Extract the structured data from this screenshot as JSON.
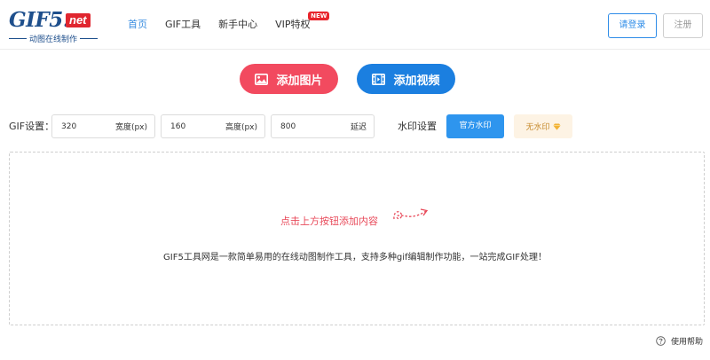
{
  "logo": {
    "main": "GIF5.",
    "net": "net",
    "subtitle": "动图在线制作"
  },
  "nav": [
    {
      "label": "首页",
      "active": true
    },
    {
      "label": "GIF工具"
    },
    {
      "label": "新手中心"
    },
    {
      "label": "VIP特权",
      "badge": "NEW"
    }
  ],
  "auth": {
    "login": "请登录",
    "register": "注册"
  },
  "add": {
    "image": "添加图片",
    "video": "添加视频"
  },
  "gif_settings": {
    "label": "GIF设置：",
    "width": {
      "value": "320",
      "unit": "宽度(px)"
    },
    "height": {
      "value": "160",
      "unit": "高度(px)"
    },
    "delay": {
      "value": "800",
      "unit": "延迟"
    }
  },
  "watermark": {
    "label": "水印设置",
    "official": "官方水印",
    "none": "无水印"
  },
  "drop_area": {
    "hint": "点击上方按钮添加内容",
    "description": "GIF5工具网是一款简单易用的在线动图制作工具，支持多种gif编辑制作功能，一站完成GIF处理！"
  },
  "help": "使用帮助",
  "colors": {
    "accent": "#2e8ce8",
    "image_button": "#f24a5f",
    "video_button": "#1b7fe0",
    "hint": "#e84a5a"
  }
}
